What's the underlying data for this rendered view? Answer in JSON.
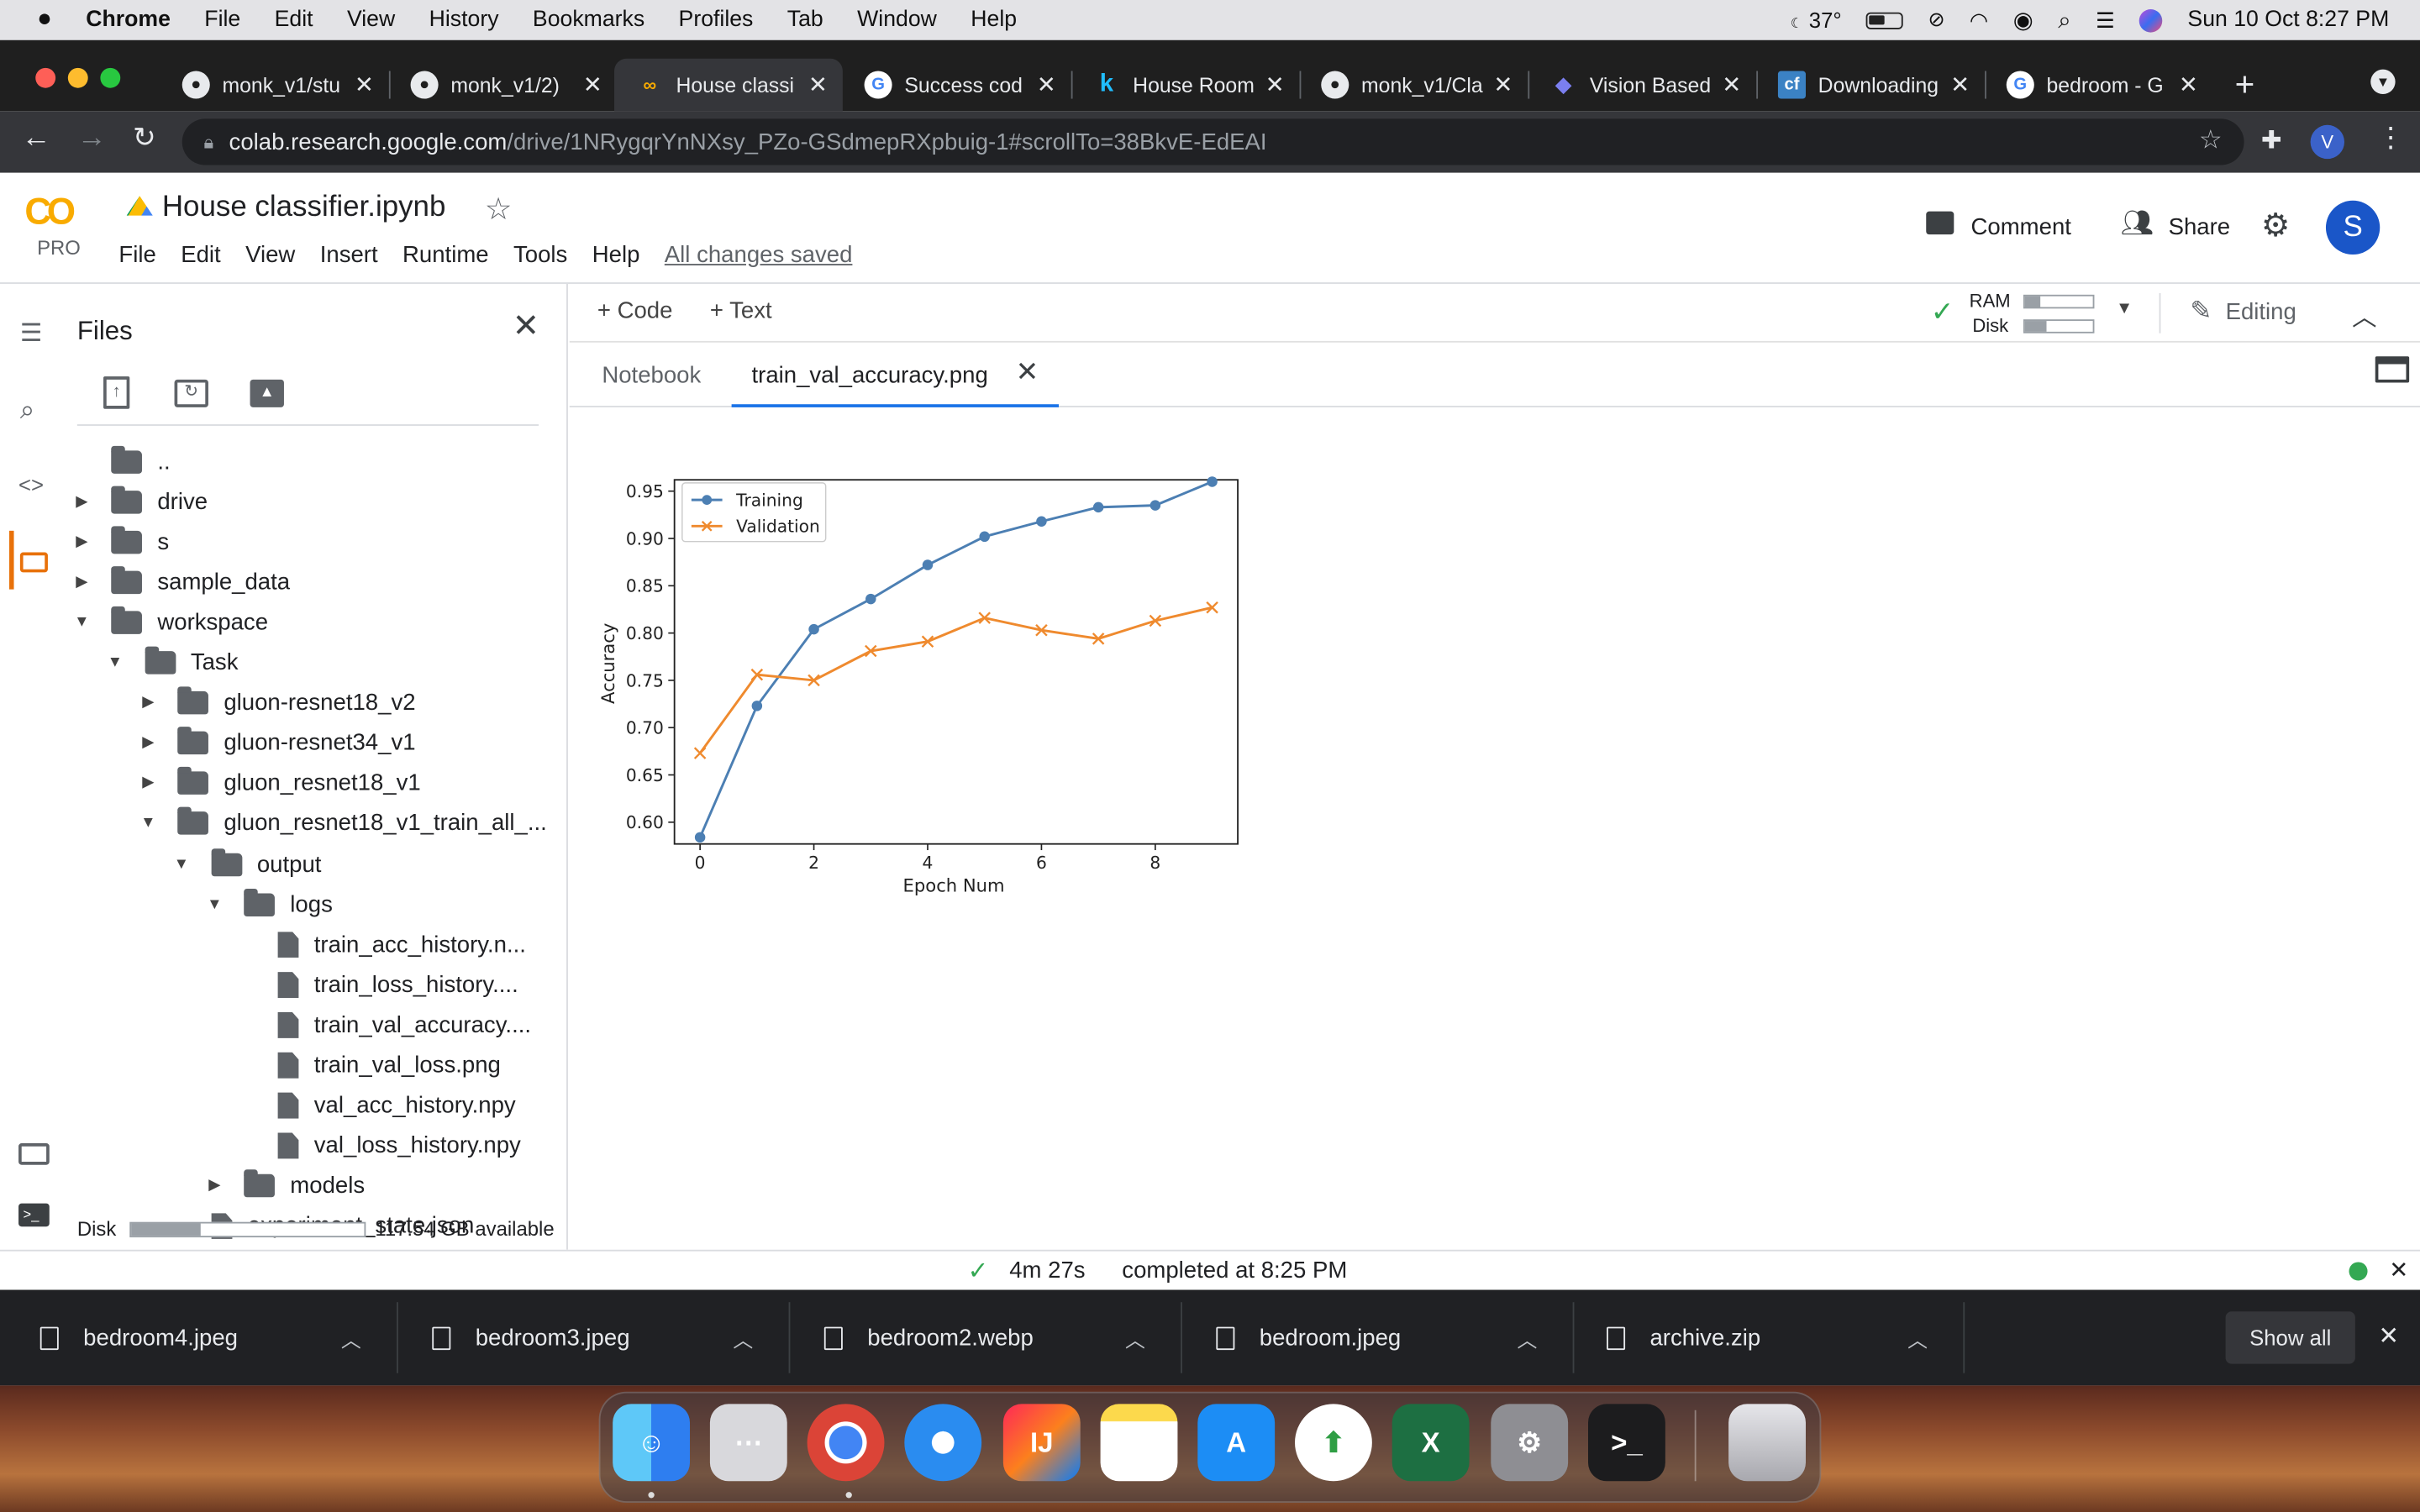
{
  "menubar": {
    "app": "Chrome",
    "items": [
      "File",
      "Edit",
      "View",
      "History",
      "Bookmarks",
      "Profiles",
      "Tab",
      "Window",
      "Help"
    ],
    "temperature": "37°",
    "datetime": "Sun 10 Oct  8:27 PM"
  },
  "tabs": [
    {
      "title": "monk_v1/stu",
      "icon": "github-icon"
    },
    {
      "title": "monk_v1/2)",
      "icon": "github-icon"
    },
    {
      "title": "House classi",
      "icon": "colab-icon",
      "active": true
    },
    {
      "title": "Success cod",
      "icon": "google-icon"
    },
    {
      "title": "House Room",
      "icon": "kaggle-icon"
    },
    {
      "title": "monk_v1/Cla",
      "icon": "github-icon"
    },
    {
      "title": "Vision Based",
      "icon": "graduation-cap-icon"
    },
    {
      "title": "Downloading",
      "icon": "codeforces-icon"
    },
    {
      "title": "bedroom - G",
      "icon": "google-icon"
    }
  ],
  "address": {
    "host": "colab.research.google.com",
    "path": "/drive/1NRygqrYnNXsy_PZo-GSdmepRXpbuig-1#scrollTo=38BkvE-EdEAI",
    "profile_letter": "V"
  },
  "colab": {
    "logo": "CO",
    "pro": "PRO",
    "notebook_title": "House classifier.ipynb",
    "menu": [
      "File",
      "Edit",
      "View",
      "Insert",
      "Runtime",
      "Tools",
      "Help"
    ],
    "saved_status": "All changes saved",
    "comment_label": "Comment",
    "share_label": "Share",
    "avatar_letter": "S"
  },
  "toolbar": {
    "code_label": "Code",
    "text_label": "Text",
    "ram_label": "RAM",
    "disk_label": "Disk",
    "editing_label": "Editing"
  },
  "editor_tabs": {
    "notebook": "Notebook",
    "image_tab": "train_val_accuracy.png"
  },
  "files_panel": {
    "title": "Files",
    "tree": [
      {
        "label": "..",
        "kind": "up",
        "depth": 0
      },
      {
        "label": "drive",
        "kind": "folder",
        "depth": 0,
        "caret": "right"
      },
      {
        "label": "s",
        "kind": "folder",
        "depth": 0,
        "caret": "right"
      },
      {
        "label": "sample_data",
        "kind": "folder",
        "depth": 0,
        "caret": "right"
      },
      {
        "label": "workspace",
        "kind": "folder",
        "depth": 0,
        "caret": "down"
      },
      {
        "label": "Task",
        "kind": "folder",
        "depth": 1,
        "caret": "down"
      },
      {
        "label": "gluon-resnet18_v2",
        "kind": "folder",
        "depth": 2,
        "caret": "right"
      },
      {
        "label": "gluon-resnet34_v1",
        "kind": "folder",
        "depth": 2,
        "caret": "right"
      },
      {
        "label": "gluon_resnet18_v1",
        "kind": "folder",
        "depth": 2,
        "caret": "right"
      },
      {
        "label": "gluon_resnet18_v1_train_all_...",
        "kind": "folder",
        "depth": 2,
        "caret": "down"
      },
      {
        "label": "output",
        "kind": "folder",
        "depth": 3,
        "caret": "down"
      },
      {
        "label": "logs",
        "kind": "folder",
        "depth": 4,
        "caret": "down"
      },
      {
        "label": "train_acc_history.n...",
        "kind": "file",
        "depth": 5
      },
      {
        "label": "train_loss_history....",
        "kind": "file",
        "depth": 5
      },
      {
        "label": "train_val_accuracy....",
        "kind": "file",
        "depth": 5
      },
      {
        "label": "train_val_loss.png",
        "kind": "file",
        "depth": 5
      },
      {
        "label": "val_acc_history.npy",
        "kind": "file",
        "depth": 5
      },
      {
        "label": "val_loss_history.npy",
        "kind": "file",
        "depth": 5
      },
      {
        "label": "models",
        "kind": "folder",
        "depth": 4,
        "caret": "right"
      },
      {
        "label": "experiment_state.json",
        "kind": "file",
        "depth": 3
      }
    ],
    "disk_label": "Disk",
    "disk_available": "117.54 GB available",
    "disk_used_fraction": 0.3
  },
  "status": {
    "duration": "4m 27s",
    "completed": "completed at 8:25 PM"
  },
  "downloads": {
    "items": [
      "bedroom4.jpeg",
      "bedroom3.jpeg",
      "bedroom2.webp",
      "bedroom.jpeg",
      "archive.zip"
    ],
    "show_all": "Show all"
  },
  "dock": [
    "finder-icon",
    "launchpad-icon",
    "chrome-icon",
    "safari-icon",
    "intellij-icon",
    "notes-icon",
    "app-store-icon",
    "anaconda-icon",
    "excel-icon",
    "system-preferences-icon",
    "terminal-icon",
    "trash-icon"
  ],
  "colors": {
    "training": "#4c7fb3",
    "validation": "#ef8a2e",
    "colab_orange": "#f9ab00",
    "link_blue": "#1a73e8"
  },
  "chart_data": {
    "type": "line",
    "xlabel": "Epoch Num",
    "ylabel": "Accuracy",
    "x": [
      0,
      1,
      2,
      3,
      4,
      5,
      6,
      7,
      8,
      9
    ],
    "xlim": [
      -0.45,
      9.45
    ],
    "ylim": [
      0.577,
      0.962
    ],
    "xticks": [
      0,
      2,
      4,
      6,
      8
    ],
    "yticks": [
      0.6,
      0.65,
      0.7,
      0.75,
      0.8,
      0.85,
      0.9,
      0.95
    ],
    "ytick_labels": [
      "0.60",
      "0.65",
      "0.70",
      "0.75",
      "0.80",
      "0.85",
      "0.90",
      "0.95"
    ],
    "legend": "upper-left",
    "series": [
      {
        "name": "Training",
        "marker": "o",
        "color": "#4c7fb3",
        "values": [
          0.584,
          0.723,
          0.804,
          0.836,
          0.872,
          0.902,
          0.918,
          0.933,
          0.935,
          0.96
        ]
      },
      {
        "name": "Validation",
        "marker": "x",
        "color": "#ef8a2e",
        "values": [
          0.673,
          0.756,
          0.75,
          0.781,
          0.791,
          0.816,
          0.803,
          0.794,
          0.813,
          0.827
        ]
      }
    ]
  }
}
